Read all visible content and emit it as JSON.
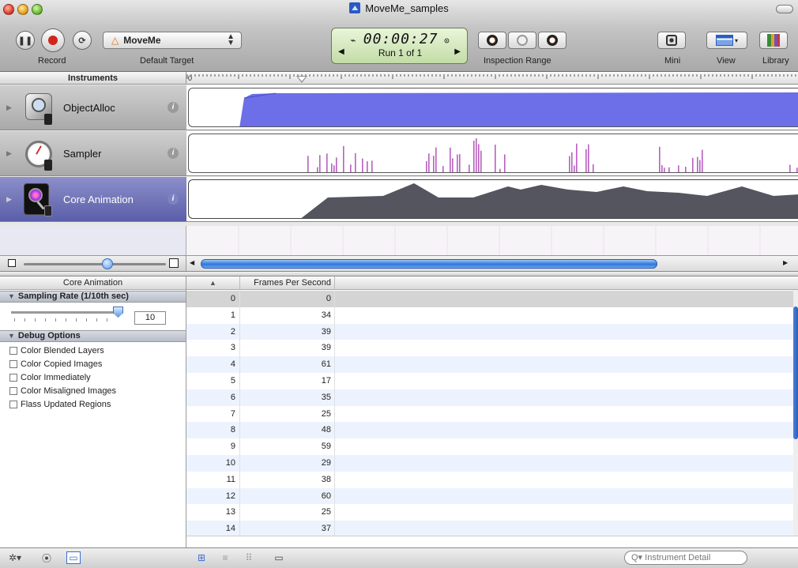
{
  "window": {
    "title": "MoveMe_samples"
  },
  "toolbar": {
    "record_label": "Record",
    "target_name": "MoveMe",
    "target_label": "Default Target",
    "timer": "00:00:27",
    "run": "Run 1 of 1",
    "inspection_label": "Inspection Range",
    "mini_label": "Mini",
    "view_label": "View",
    "library_label": "Library"
  },
  "instruments_header": "Instruments",
  "ruler_zero": "0",
  "instruments": [
    {
      "name": "ObjectAlloc",
      "info": "i"
    },
    {
      "name": "Sampler",
      "info": "i"
    },
    {
      "name": "Core Animation",
      "info": "i"
    }
  ],
  "config": {
    "title": "Core Animation",
    "sampling_section": "Sampling Rate (1/10th sec)",
    "sampling_value": "10",
    "debug_section": "Debug Options",
    "options": [
      "Color Blended Layers",
      "Color Copied Images",
      "Color Immediately",
      "Color Misaligned Images",
      "Flass Updated Regions"
    ]
  },
  "table": {
    "columns": [
      "▲",
      "Frames Per Second"
    ],
    "rows": [
      [
        "0",
        "0"
      ],
      [
        "1",
        "34"
      ],
      [
        "2",
        "39"
      ],
      [
        "3",
        "39"
      ],
      [
        "4",
        "61"
      ],
      [
        "5",
        "17"
      ],
      [
        "6",
        "35"
      ],
      [
        "7",
        "25"
      ],
      [
        "8",
        "48"
      ],
      [
        "9",
        "59"
      ],
      [
        "10",
        "29"
      ],
      [
        "11",
        "38"
      ],
      [
        "12",
        "60"
      ],
      [
        "13",
        "25"
      ],
      [
        "14",
        "37"
      ]
    ]
  },
  "search": {
    "placeholder": "Instrument Detail"
  },
  "colors": {
    "accent": "#5a5ea8",
    "alloc": "#6d6fe8",
    "sampler": "#b85fc0",
    "coreanim": "#555560"
  }
}
